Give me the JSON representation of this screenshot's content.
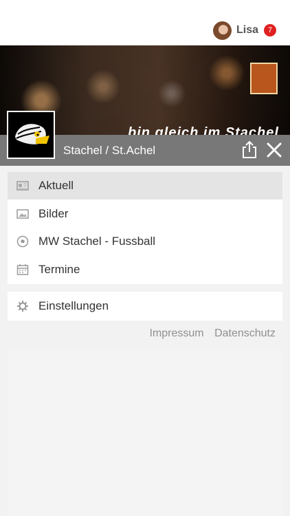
{
  "header": {
    "user_name": "Lisa",
    "notification_count": "7",
    "avatar_icon": "avatar-photo"
  },
  "hero": {
    "club_title": "Stachel / St.Achel",
    "script_text": "bin gleich im Stachel"
  },
  "menu": {
    "items": [
      {
        "label": "Aktuell",
        "icon": "newspaper-icon",
        "active": true
      },
      {
        "label": "Bilder",
        "icon": "image-icon",
        "active": false
      },
      {
        "label": "MW Stachel - Fussball",
        "icon": "soccer-ball-icon",
        "active": false
      },
      {
        "label": "Termine",
        "icon": "calendar-icon",
        "active": false
      }
    ],
    "settings_label": "Einstellungen"
  },
  "footer": {
    "impressum": "Impressum",
    "datenschutz": "Datenschutz"
  },
  "colors": {
    "badge": "#e02020",
    "bar": "#6e6e6e",
    "active_row": "#e4e4e4"
  }
}
